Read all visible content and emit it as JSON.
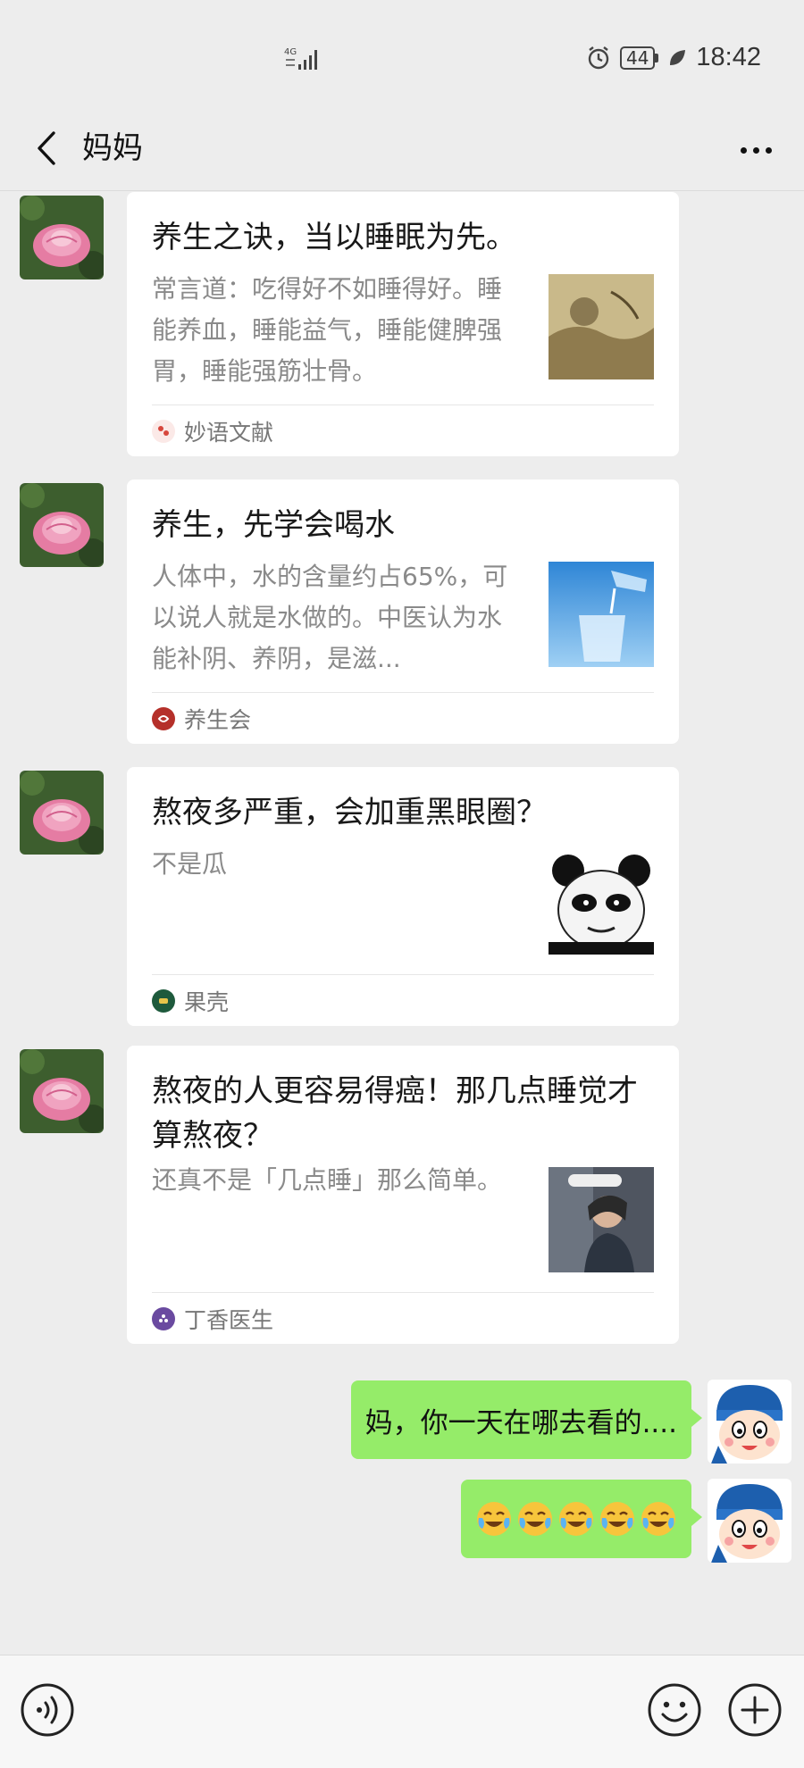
{
  "status_bar": {
    "network": "4G",
    "battery": "44",
    "time": "18:42"
  },
  "header": {
    "title": "妈妈"
  },
  "messages": [
    {
      "type": "article",
      "title": "养生之诀，当以睡眠为先。",
      "desc": "常言道：吃得好不如睡得好。睡能养血，睡能益气，睡能健脾强胃，睡能强筋壮骨。",
      "source": "妙语文献",
      "source_color": "#d7463c"
    },
    {
      "type": "article",
      "title": "养生，先学会喝水",
      "desc": "人体中，水的含量约占65%，可以说人就是水做的。中医认为水能补阴、养阴，是滋...",
      "source": "养生会",
      "source_color": "#b5302a"
    },
    {
      "type": "article",
      "title": "熬夜多严重，会加重黑眼圈？",
      "desc": "不是瓜",
      "source": "果壳",
      "source_color": "#1e5a3c"
    },
    {
      "type": "article",
      "title": "熬夜的人更容易得癌！那几点睡觉才算熬夜？",
      "desc": "还真不是「几点睡」那么简单。",
      "source": "丁香医生",
      "source_color": "#6a4aa0"
    },
    {
      "type": "text",
      "text": "妈，你一天在哪去看的...."
    },
    {
      "type": "emoji",
      "emojis": [
        "face-with-tears-of-joy",
        "face-with-tears-of-joy",
        "face-with-tears-of-joy",
        "face-with-tears-of-joy",
        "face-with-tears-of-joy"
      ]
    }
  ],
  "colors": {
    "bubble_green": "#95ec69",
    "background": "#ededed",
    "card": "#ffffff"
  },
  "icons": [
    "back-arrow-icon",
    "more-icon",
    "voice-icon",
    "emoji-icon",
    "plus-icon"
  ]
}
